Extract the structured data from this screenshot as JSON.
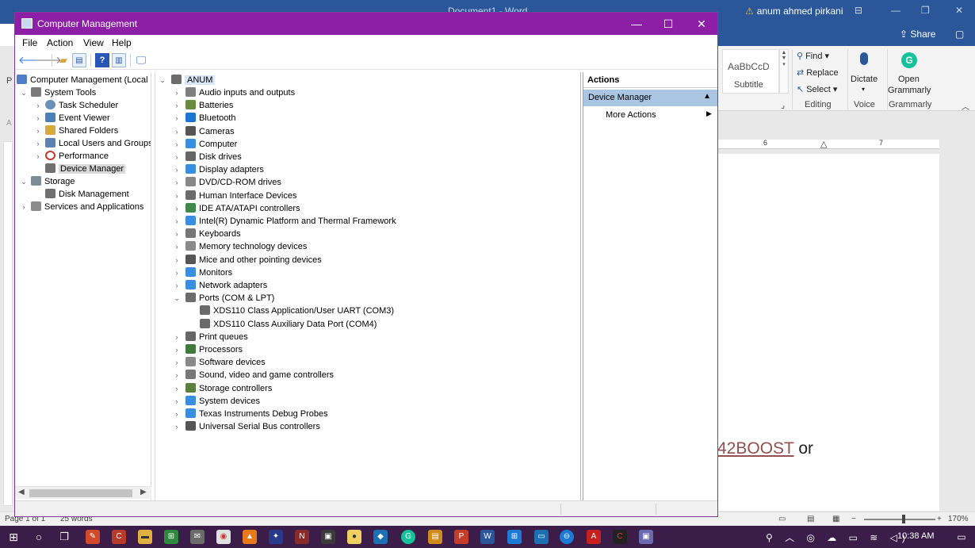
{
  "word": {
    "doc_title": "Document1 - Word",
    "user": "anum ahmed pirkani",
    "share": "Share",
    "styles": {
      "preview": "AaBbCcD",
      "name": "Subtitle"
    },
    "editing": {
      "find": "Find",
      "replace": "Replace",
      "select": "Select",
      "group": "Editing"
    },
    "voice": {
      "button": "Dictate",
      "group": "Voice"
    },
    "grammarly": {
      "button_line1": "Open",
      "button_line2": "Grammarly",
      "group": "Grammarly"
    },
    "ruler_marks": [
      "6",
      "7"
    ],
    "page_text": {
      "link": "42BOOST",
      "after": " or"
    },
    "status": {
      "page": "Page 1 of 1",
      "words": "25 words",
      "zoom": "170%"
    },
    "left_labels": {
      "p": "P",
      "a": "A"
    }
  },
  "taskbar": {
    "clock": "10:38 AM"
  },
  "cm": {
    "title": "Computer Management",
    "menu": [
      "File",
      "Action",
      "View",
      "Help"
    ],
    "tree": [
      {
        "label": "Computer Management (Local",
        "expander": "",
        "icon_color": "#4f7ec7"
      },
      {
        "label": "System Tools",
        "expander": "⌄",
        "icon_color": "#7a7a7a"
      },
      {
        "label": "Task Scheduler",
        "expander": "›",
        "icon_color": "#6c8fb8"
      },
      {
        "label": "Event Viewer",
        "expander": "›",
        "icon_color": "#4c7fb8"
      },
      {
        "label": "Shared Folders",
        "expander": "›",
        "icon_color": "#d8a93c"
      },
      {
        "label": "Local Users and Groups",
        "expander": "›",
        "icon_color": "#5a83b4"
      },
      {
        "label": "Performance",
        "expander": "›",
        "icon_color": "#c0392b"
      },
      {
        "label": "Device Manager",
        "expander": "",
        "icon_color": "#6f6f6f"
      },
      {
        "label": "Storage",
        "expander": "⌄",
        "icon_color": "#7e8c99"
      },
      {
        "label": "Disk Management",
        "expander": "",
        "icon_color": "#6f6f6f"
      },
      {
        "label": "Services and Applications",
        "expander": "›",
        "icon_color": "#8c8c8c"
      }
    ],
    "devices_root": "ANUM",
    "devices": [
      {
        "label": "Audio inputs and outputs",
        "expander": "›",
        "icon_color": "#7f7f7f"
      },
      {
        "label": "Batteries",
        "expander": "›",
        "icon_color": "#6a8a3e"
      },
      {
        "label": "Bluetooth",
        "expander": "›",
        "icon_color": "#1e74d2"
      },
      {
        "label": "Cameras",
        "expander": "›",
        "icon_color": "#555555"
      },
      {
        "label": "Computer",
        "expander": "›",
        "icon_color": "#3a8ee0"
      },
      {
        "label": "Disk drives",
        "expander": "›",
        "icon_color": "#666666"
      },
      {
        "label": "Display adapters",
        "expander": "›",
        "icon_color": "#3a8ee0"
      },
      {
        "label": "DVD/CD-ROM drives",
        "expander": "›",
        "icon_color": "#888888"
      },
      {
        "label": "Human Interface Devices",
        "expander": "›",
        "icon_color": "#6b6b6b"
      },
      {
        "label": "IDE ATA/ATAPI controllers",
        "expander": "›",
        "icon_color": "#3f8a4a"
      },
      {
        "label": "Intel(R) Dynamic Platform and Thermal Framework",
        "expander": "›",
        "icon_color": "#3a8ee0"
      },
      {
        "label": "Keyboards",
        "expander": "›",
        "icon_color": "#777777"
      },
      {
        "label": "Memory technology devices",
        "expander": "›",
        "icon_color": "#8a8a8a"
      },
      {
        "label": "Mice and other pointing devices",
        "expander": "›",
        "icon_color": "#555555"
      },
      {
        "label": "Monitors",
        "expander": "›",
        "icon_color": "#3a8ee0"
      },
      {
        "label": "Network adapters",
        "expander": "›",
        "icon_color": "#3a8ee0"
      },
      {
        "label": "Ports (COM & LPT)",
        "expander": "⌄",
        "icon_color": "#6b6b6b"
      },
      {
        "label": "XDS110 Class Application/User UART (COM3)",
        "expander": "",
        "icon_color": "#6b6b6b",
        "child": true
      },
      {
        "label": "XDS110 Class Auxiliary Data Port (COM4)",
        "expander": "",
        "icon_color": "#6b6b6b",
        "child": true
      },
      {
        "label": "Print queues",
        "expander": "›",
        "icon_color": "#666666"
      },
      {
        "label": "Processors",
        "expander": "›",
        "icon_color": "#3f7a3f"
      },
      {
        "label": "Software devices",
        "expander": "›",
        "icon_color": "#8a8a8a"
      },
      {
        "label": "Sound, video and game controllers",
        "expander": "›",
        "icon_color": "#777777"
      },
      {
        "label": "Storage controllers",
        "expander": "›",
        "icon_color": "#5c7f3e"
      },
      {
        "label": "System devices",
        "expander": "›",
        "icon_color": "#3a8ee0"
      },
      {
        "label": "Texas Instruments Debug Probes",
        "expander": "›",
        "icon_color": "#3a8ee0"
      },
      {
        "label": "Universal Serial Bus controllers",
        "expander": "›",
        "icon_color": "#555555"
      }
    ],
    "actions": {
      "header": "Actions",
      "section": "Device Manager",
      "item": "More Actions"
    }
  }
}
